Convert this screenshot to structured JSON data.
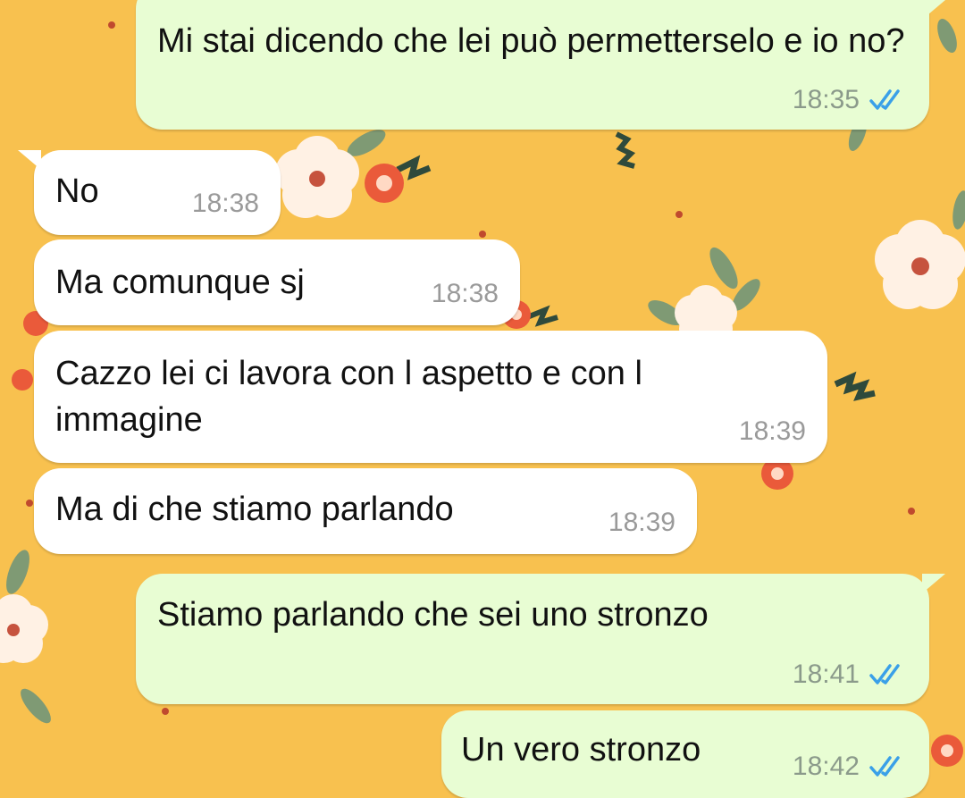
{
  "chat": {
    "messages": [
      {
        "direction": "outgoing",
        "text": "Mi stai dicendo che lei può permetterselo e io no?",
        "time": "18:35",
        "status": "read"
      },
      {
        "direction": "incoming",
        "text": "No",
        "time": "18:38"
      },
      {
        "direction": "incoming",
        "text": "Ma comunque sj",
        "time": "18:38"
      },
      {
        "direction": "incoming",
        "text": "Cazzo lei ci lavora con l aspetto e con l immagine",
        "time": "18:39"
      },
      {
        "direction": "incoming",
        "text": "Ma di che stiamo parlando",
        "time": "18:39"
      },
      {
        "direction": "outgoing",
        "text": "Stiamo parlando che sei uno stronzo",
        "time": "18:41",
        "status": "read"
      },
      {
        "direction": "outgoing",
        "text": "Un vero stronzo",
        "time": "18:42",
        "status": "read"
      }
    ]
  },
  "theme": {
    "wallpaper_color": "#f8c14f",
    "outgoing_bubble_color": "#e8fdd3",
    "incoming_bubble_color": "#ffffff",
    "read_tick_color": "#3aa0e8",
    "wallpaper_pattern": "floral-pattern"
  }
}
